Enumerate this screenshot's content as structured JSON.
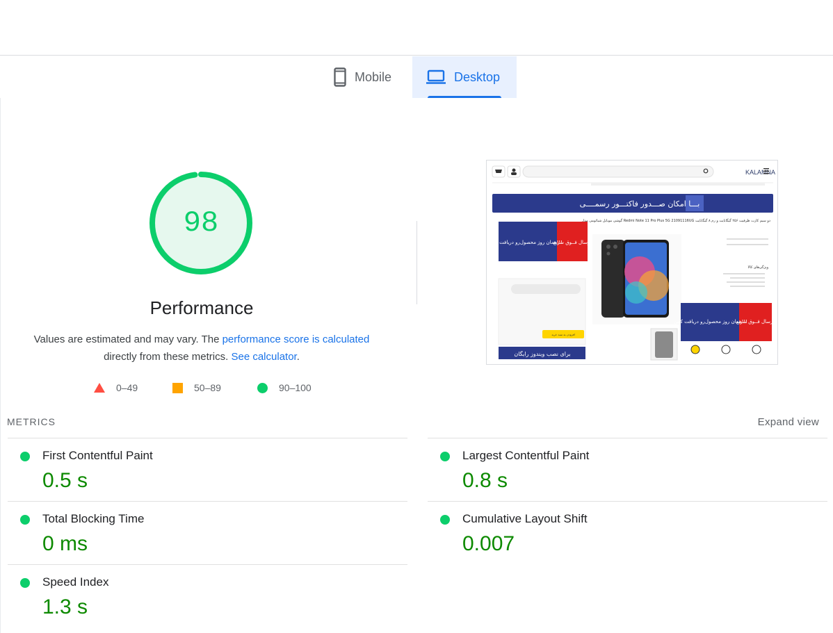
{
  "tabs": {
    "mobile_label": "Mobile",
    "desktop_label": "Desktop"
  },
  "performance": {
    "score": "98",
    "score_value": 98,
    "title": "Performance",
    "desc_text_1": "Values are estimated and may vary. The ",
    "desc_link_1": "performance score is calculated",
    "desc_text_2": " directly from these metrics. ",
    "desc_link_2": "See calculator",
    "desc_text_3": "."
  },
  "legend": {
    "fail_range": "0–49",
    "average_range": "50–89",
    "pass_range": "90–100"
  },
  "colors": {
    "pass": "#0cce6b",
    "pass_fill": "#e6f8ee",
    "average": "#ffa400",
    "fail": "#ff4e42",
    "link": "#1a73e8",
    "metric_value": "#0d8a00"
  },
  "metrics": {
    "section_label": "METRICS",
    "expand_label": "Expand view",
    "fcp": {
      "name": "First Contentful Paint",
      "value": "0.5 s"
    },
    "lcp": {
      "name": "Largest Contentful Paint",
      "value": "0.8 s"
    },
    "tbt": {
      "name": "Total Blocking Time",
      "value": "0 ms"
    },
    "cls": {
      "name": "Cumulative Layout Shift",
      "value": "0.007"
    },
    "si": {
      "name": "Speed Index",
      "value": "1.3 s"
    }
  },
  "screenshot": {
    "brand": "KALAMNA",
    "banner_text": "بـــا امکان صـــدور فاکتـــور رسمــــی",
    "product_title": "گوشی موبایل شیائومی مدل Redmi Note 11 Pro Plus 5G 21091116UG دو سیم کارت ظرفیت ۲۵۶ گیگابایت و رم ۸ گیگابایت",
    "ad_left_red": "ارسال فــوق سریع",
    "ad_left_blue": "همان روز محصول‌رو دریافت کنین!!!",
    "ad_right_red": "ارسال فــوق سریع",
    "ad_right_blue": "همان روز محصول‌رو دریافت کنین!!!",
    "windows_text": "برای نصب ویندوز رایگان",
    "add_to_cart": "افزودن به سبد خرید",
    "features_title": "ویژگی‌های کالا"
  }
}
